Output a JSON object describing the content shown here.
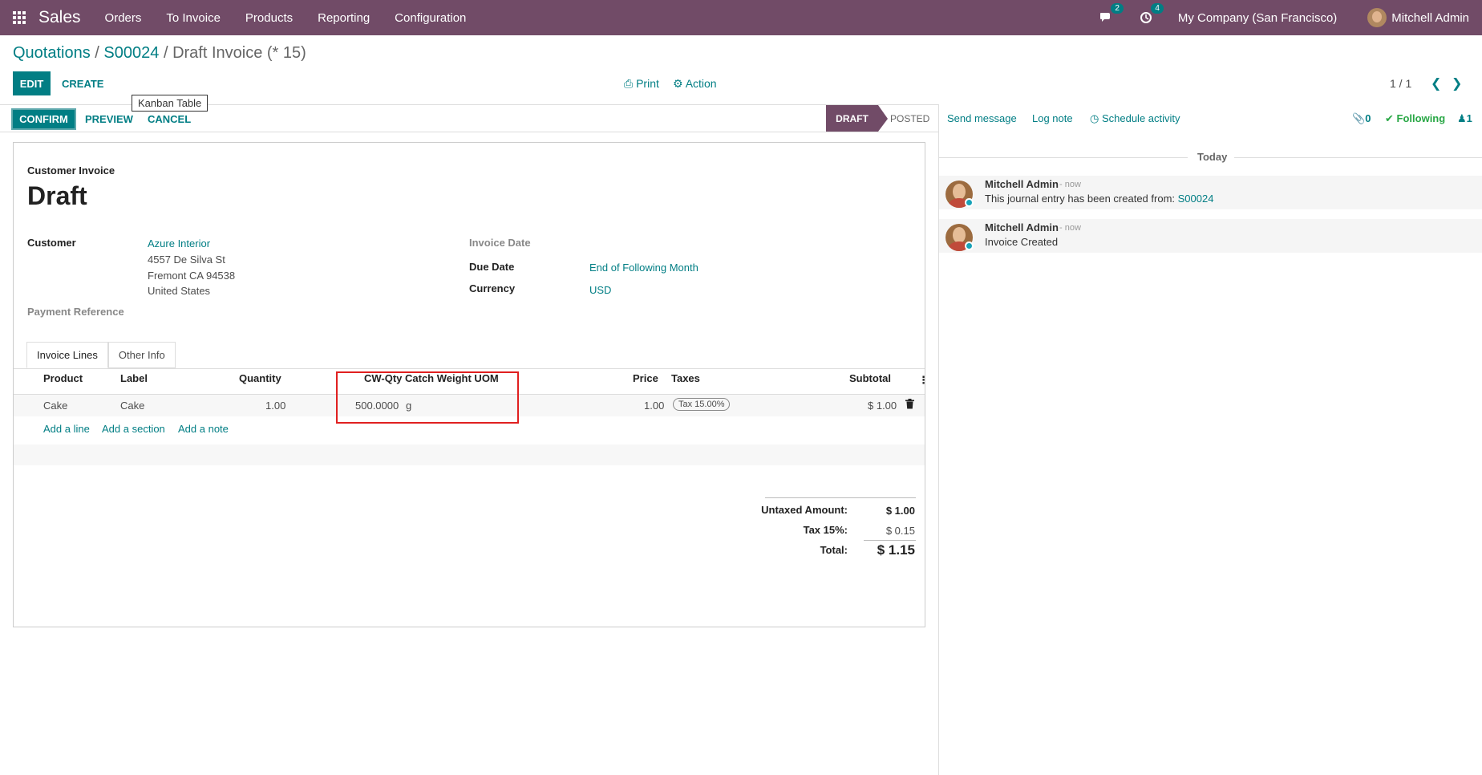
{
  "navbar": {
    "app_name": "Sales",
    "menu": [
      "Orders",
      "To Invoice",
      "Products",
      "Reporting",
      "Configuration"
    ],
    "messages_count": "2",
    "activities_count": "4",
    "company": "My Company (San Francisco)",
    "user": "Mitchell Admin"
  },
  "breadcrumb": {
    "level1": "Quotations",
    "sep1": "/",
    "level2": "S00024",
    "sep2": "/",
    "current": "Draft Invoice (* 15)"
  },
  "control": {
    "edit": "EDIT",
    "create": "CREATE",
    "print": "Print",
    "action": "Action",
    "pager": "1 / 1",
    "tooltip": "Kanban Table"
  },
  "statusbar": {
    "confirm": "CONFIRM",
    "preview": "PREVIEW",
    "cancel": "CANCEL",
    "stages": [
      "DRAFT",
      "POSTED"
    ],
    "active_stage": "DRAFT"
  },
  "form": {
    "type": "Customer Invoice",
    "name": "Draft",
    "customer_label": "Customer",
    "customer_name": "Azure Interior",
    "address": [
      "4557 De Silva St",
      "Fremont CA 94538",
      "United States"
    ],
    "payment_ref_label": "Payment Reference",
    "invoice_date_label": "Invoice Date",
    "due_date_label": "Due Date",
    "due_date_value": "End of Following Month",
    "currency_label": "Currency",
    "currency_value": "USD"
  },
  "tabs": [
    "Invoice Lines",
    "Other Info"
  ],
  "lines": {
    "headers": [
      "Product",
      "Label",
      "Quantity",
      "CW-Qty",
      "Catch Weight UOM",
      "Price",
      "Taxes",
      "Subtotal"
    ],
    "rows": [
      {
        "product": "Cake",
        "label": "Cake",
        "quantity": "1.00",
        "cw_qty": "500.0000",
        "cw_uom": "g",
        "price": "1.00",
        "taxes": "Tax 15.00%",
        "subtotal": "$ 1.00"
      }
    ],
    "add_line": "Add a line",
    "add_section": "Add a section",
    "add_note": "Add a note"
  },
  "totals": {
    "untaxed_label": "Untaxed Amount:",
    "untaxed_value": "$ 1.00",
    "tax_label": "Tax 15%:",
    "tax_value": "$ 0.15",
    "total_label": "Total:",
    "total_value": "$ 1.15"
  },
  "chatter": {
    "send_message": "Send message",
    "log_note": "Log note",
    "schedule_activity": "Schedule activity",
    "attachments": "0",
    "following": "Following",
    "followers": "1",
    "date_separator": "Today",
    "messages": [
      {
        "author": "Mitchell Admin",
        "date": "- now",
        "body": "This journal entry has been created from:",
        "link": "S00024"
      },
      {
        "author": "Mitchell Admin",
        "date": "- now",
        "body": "Invoice Created",
        "link": ""
      }
    ]
  },
  "colors": {
    "brand": "#714b67",
    "accent": "#017e84",
    "highlight": "#e02020",
    "following": "#28a745"
  }
}
